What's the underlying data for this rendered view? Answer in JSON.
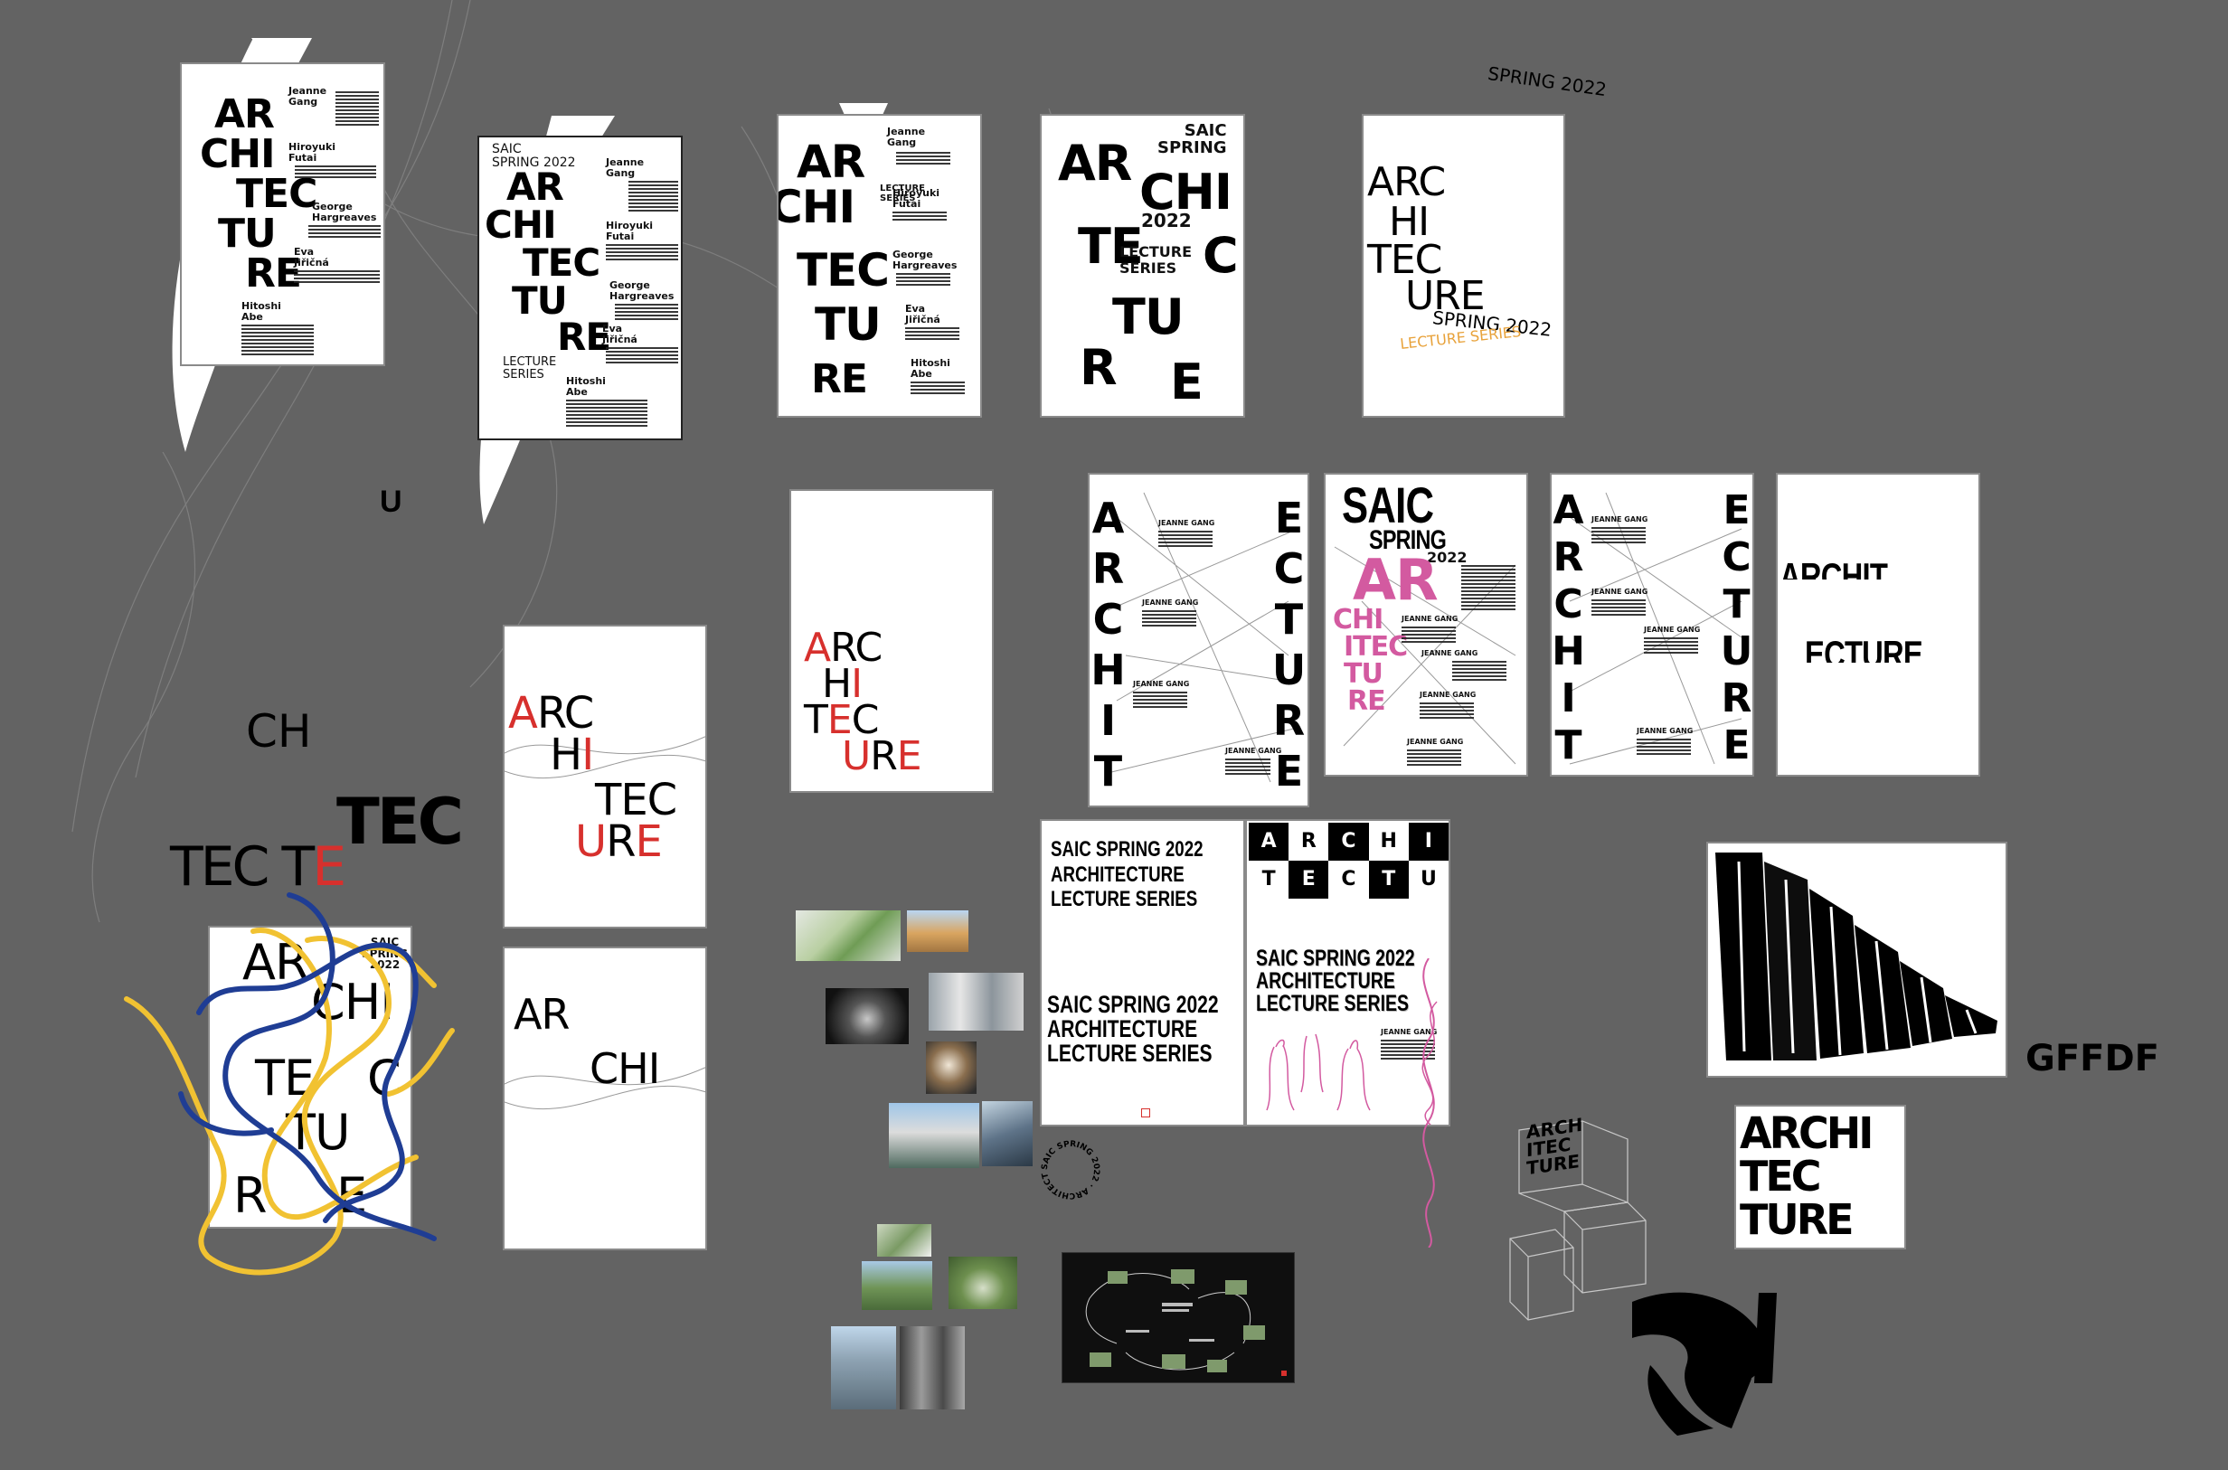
{
  "canvas": {
    "background": "#636363"
  },
  "posters": {
    "p1": {
      "title_lines": [
        "AR",
        "CHI",
        "TEC",
        "TU",
        "RE"
      ],
      "names": [
        "Jeanne Gang",
        "Hiroyuki Futai",
        "George Hargreaves",
        "Eva Jiřičná",
        "Hitoshi Abe"
      ]
    },
    "p2": {
      "header": "SAIC\nSPRING 2022",
      "title_lines": [
        "AR",
        "CHI",
        "TEC",
        "TU",
        "RE"
      ],
      "subtitle": "LECTURE\nSERIES",
      "names": [
        "Jeanne Gang",
        "Hiroyuki Futai",
        "George Hargreaves",
        "Eva Jiřičná",
        "Hitoshi Abe"
      ]
    },
    "p3": {
      "title_lines": [
        "AR",
        "CHI",
        "TEC",
        "TU",
        "RE"
      ],
      "red_names": [
        "Jeanne Gang",
        "Hiroyuki Futai",
        "George Hargreaves",
        "Eva Jiřičná",
        "Hitoshi Abe"
      ],
      "red_label": "LECTURE\nSERIES"
    },
    "p4": {
      "title_lines": [
        "AR",
        "TE",
        "TU",
        "R",
        "E"
      ],
      "red_header": "SAIC\nSPRING",
      "red_year": "2022",
      "red_label": "LECTURE\nSERIES",
      "black_extra": [
        "CHI",
        "C"
      ]
    },
    "p5": {
      "title_lines": [
        "ARC",
        "HI",
        "TEC",
        "URE"
      ],
      "spring": "SPRING 2022",
      "series": "LECTURE SERIES"
    },
    "p6": {
      "title_lines": [
        "ARC",
        "HI",
        "TEC",
        "URE"
      ]
    },
    "p7": {
      "left_letters": [
        "A",
        "R",
        "C",
        "H",
        "I",
        "T"
      ],
      "right_letters": [
        "E",
        "C",
        "T",
        "U",
        "R",
        "E"
      ],
      "names": [
        "JEANNE GANG",
        "JEANNE GANG",
        "JEANNE GANG",
        "JEANNE GANG"
      ]
    },
    "p8": {
      "header": "SAIC",
      "sub": "SPRING",
      "year": "2022",
      "title_lines": [
        "AR",
        "CHI",
        "ITEC",
        "TU",
        "RE"
      ],
      "names": [
        "JEANNE GANG",
        "JEANNE GANG",
        "JEANNE GANG",
        "JEANNE GANG"
      ]
    },
    "p9": {
      "left_letters": [
        "A",
        "R",
        "C",
        "H",
        "I",
        "T"
      ],
      "right_letters": [
        "E",
        "C",
        "T",
        "U",
        "R",
        "E"
      ],
      "names": [
        "JEANNE GANG",
        "JEANNE GANG",
        "JEANNE GANG",
        "JEANNE GANG"
      ]
    },
    "p10": {
      "line1": "ARCHIT",
      "line2": "ECTURE"
    },
    "p11": {
      "title_lines": [
        "ARC",
        "HI",
        "TEC",
        "URE"
      ]
    },
    "p12": {
      "left": "AR",
      "right": "CHI"
    },
    "p13": {
      "header": "SAIC\nSPRING\n2022",
      "title_lines": [
        "AR",
        "CHI",
        "TE",
        "C",
        "TU",
        "R",
        "E"
      ]
    },
    "p14": {
      "top": "SAIC SPRING 2022\nARCHITECTURE\nLECTURE SERIES",
      "bottom": "SAIC SPRING 2022\nARCHITECTURE\nLECTURE SERIES"
    },
    "p15": {
      "grid_row1": [
        "A",
        "R",
        "C",
        "H",
        "I"
      ],
      "grid_row2": [
        "T",
        "E",
        "C",
        "T",
        "U"
      ],
      "text": "SAIC SPRING 2022\nARCHITECTURE\nLECTURE SERIES",
      "name": "JEANNE GANG"
    },
    "p16": {
      "warped": "ARCHITECTURE"
    },
    "p17": {
      "lines": [
        "ARCHI",
        "TEC",
        "TURE"
      ]
    }
  },
  "loose_text": {
    "spring_2022": "SPRING 2022",
    "ch": "CH",
    "tec_small": "TEC TE",
    "tec_big": "TEC",
    "u_glyph": "U",
    "gffdf": "GFFDF",
    "cube_label": "ARCH\nITEC\nTURE",
    "circle_text": "SAIC SPRING 2022 · ARCHITECTURE LECTURE SERIES ·",
    "swirl": "ARCHI TURE"
  },
  "colors": {
    "red": "#d7302d",
    "pink": "#d35aa0",
    "orange": "#e8a23a",
    "blue": "#1f3d94",
    "yellow": "#f1c232"
  }
}
